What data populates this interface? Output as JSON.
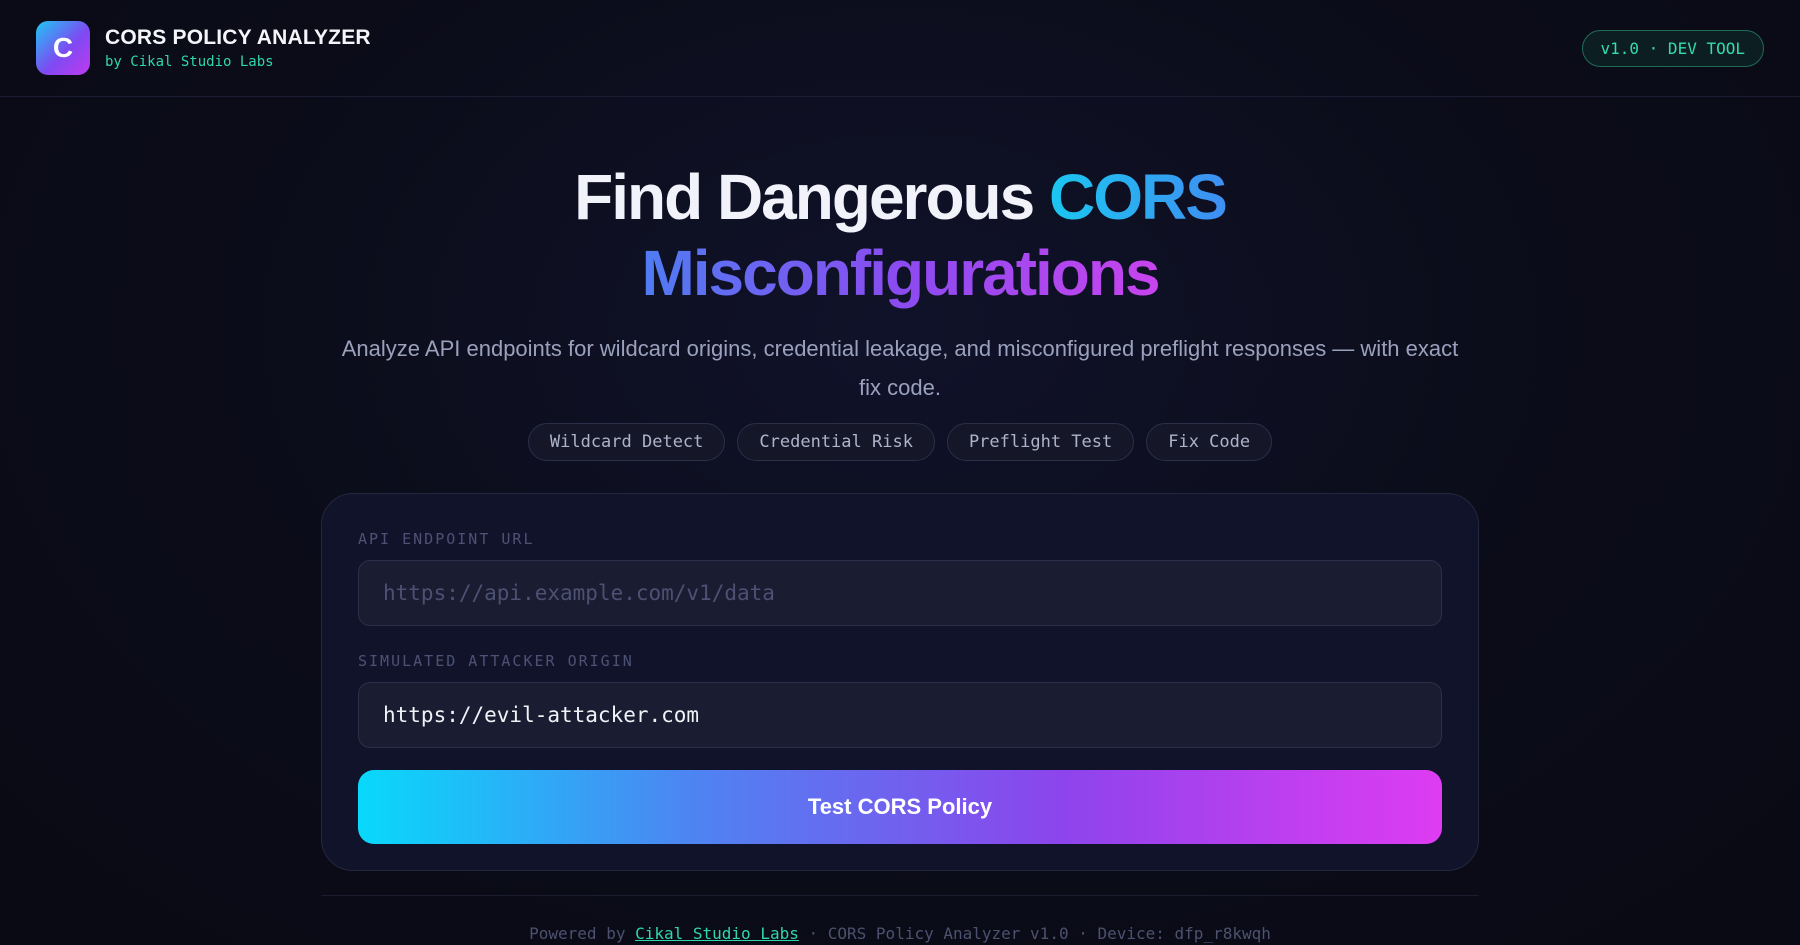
{
  "header": {
    "logo_letter": "C",
    "title": "CORS POLICY ANALYZER",
    "subtitle": "by Cikal Studio Labs",
    "version_badge": "v1.0 · DEV TOOL"
  },
  "hero": {
    "headline_part1": "Find Dangerous ",
    "headline_highlight1": "CORS",
    "headline_line2": "Misconfigurations",
    "description": "Analyze API endpoints for wildcard origins, credential leakage, and misconfigured preflight responses — with exact fix code.",
    "tags": [
      "Wildcard Detect",
      "Credential Risk",
      "Preflight Test",
      "Fix Code"
    ]
  },
  "form": {
    "endpoint_label": "API ENDPOINT URL",
    "endpoint_placeholder": "https://api.example.com/v1/data",
    "endpoint_value": "",
    "origin_label": "SIMULATED ATTACKER ORIGIN",
    "origin_value": "https://evil-attacker.com",
    "submit_label": "Test CORS Policy"
  },
  "footer": {
    "prefix": "Powered by ",
    "link_text": "Cikal Studio Labs",
    "suffix": " · CORS Policy Analyzer v1.0 · Device: dfp_r8kwqh"
  },
  "colors": {
    "background": "#0b0c18",
    "accent_cyan": "#1bc7f0",
    "accent_purple": "#8b4bf0",
    "accent_magenta": "#de3cf2",
    "accent_green": "#2fd7a9"
  }
}
